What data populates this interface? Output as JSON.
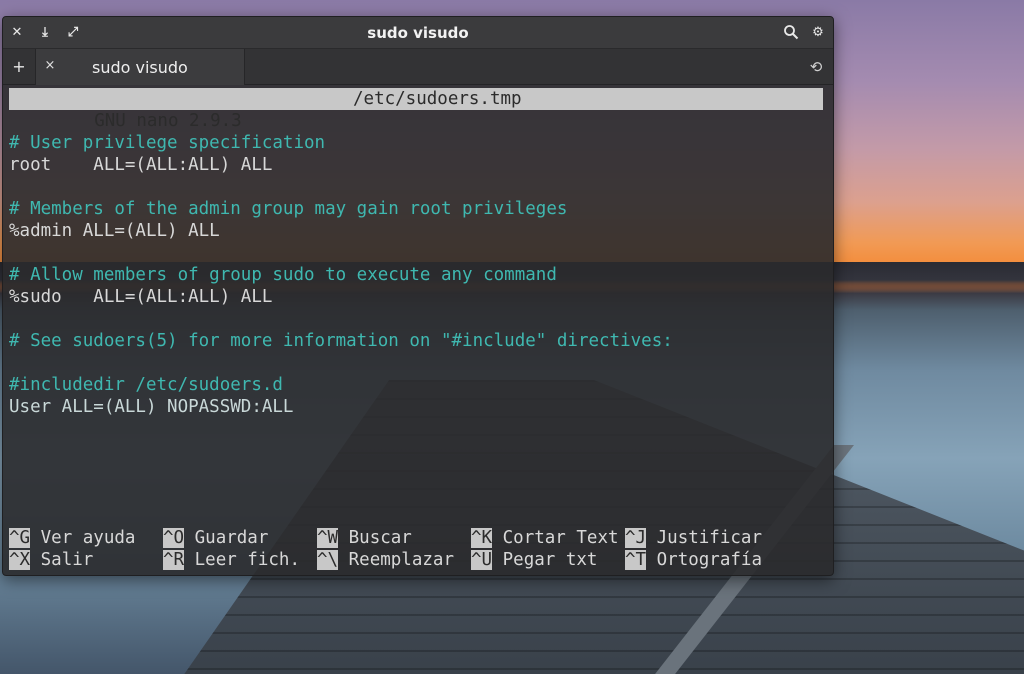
{
  "window": {
    "title": "sudo visudo",
    "close_icon": "close-icon",
    "minimize_icon": "minimize-icon",
    "maximize_icon": "maximize-icon",
    "search_icon": "search-icon",
    "gear_icon": "gear-icon"
  },
  "tabs": {
    "new_tab": "+",
    "active_tab": {
      "label": "sudo visudo",
      "close": "×"
    },
    "history_icon": "history-icon"
  },
  "nano": {
    "version": "GNU nano 2.9.3",
    "filename": "/etc/sudoers.tmp"
  },
  "lines": [
    {
      "text": "# User privilege specification",
      "type": "comment"
    },
    {
      "text": "root    ALL=(ALL:ALL) ALL",
      "type": "code"
    },
    {
      "text": "",
      "type": "blank"
    },
    {
      "text": "# Members of the admin group may gain root privileges",
      "type": "comment"
    },
    {
      "text": "%admin ALL=(ALL) ALL",
      "type": "code"
    },
    {
      "text": "",
      "type": "blank"
    },
    {
      "text": "# Allow members of group sudo to execute any command",
      "type": "comment"
    },
    {
      "text": "%sudo   ALL=(ALL:ALL) ALL",
      "type": "code"
    },
    {
      "text": "",
      "type": "blank"
    },
    {
      "text": "# See sudoers(5) for more information on \"#include\" directives:",
      "type": "comment"
    },
    {
      "text": "",
      "type": "blank"
    },
    {
      "text": "#includedir /etc/sudoers.d",
      "type": "comment"
    },
    {
      "text": "User ALL=(ALL) NOPASSWD:ALL",
      "type": "code"
    }
  ],
  "shortcuts": [
    {
      "key": "^G",
      "label": "Ver ayuda"
    },
    {
      "key": "^O",
      "label": "Guardar"
    },
    {
      "key": "^W",
      "label": "Buscar"
    },
    {
      "key": "^K",
      "label": "Cortar Text"
    },
    {
      "key": "^J",
      "label": "Justificar"
    },
    {
      "key": "^X",
      "label": "Salir"
    },
    {
      "key": "^R",
      "label": "Leer fich."
    },
    {
      "key": "^\\",
      "label": "Reemplazar"
    },
    {
      "key": "^U",
      "label": "Pegar txt"
    },
    {
      "key": "^T",
      "label": "Ortografía"
    }
  ]
}
